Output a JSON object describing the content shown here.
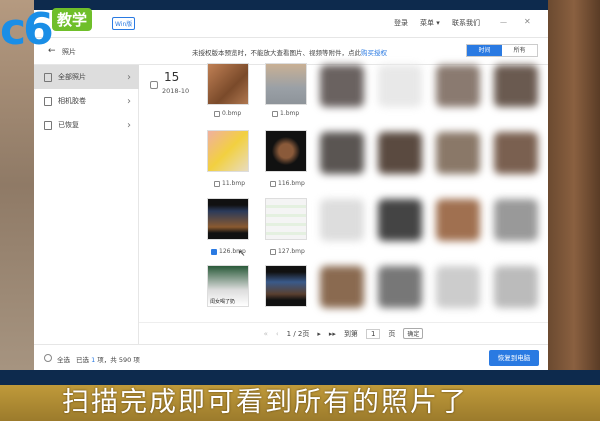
{
  "logo": {
    "text": "c6",
    "badge": "教学"
  },
  "titlebar": {
    "edition": "Win版",
    "login": "登录",
    "menu": "菜单 ▾",
    "contact": "联系我们",
    "minimize": "—",
    "close": "✕"
  },
  "toolbar": {
    "back": "←",
    "title": "照片",
    "notice": "未授权版本预览时，不能放大查看图片、视频等附件，点此",
    "buy": "购买授权",
    "tab_time": "时间",
    "tab_all": "所有"
  },
  "sidebar": {
    "items": [
      {
        "label": "全部照片"
      },
      {
        "label": "相机胶卷"
      },
      {
        "label": "已恢复"
      }
    ]
  },
  "group": {
    "day": "15",
    "month": "2018-10"
  },
  "photos": [
    {
      "name": "0.bmp",
      "checked": false
    },
    {
      "name": "1.bmp",
      "checked": false
    },
    {
      "name": "11.bmp",
      "checked": false
    },
    {
      "name": "116.bmp",
      "checked": false
    },
    {
      "name": "126.bmp",
      "checked": true
    },
    {
      "name": "127.bmp",
      "checked": false
    }
  ],
  "meme_caption": "闺女喝了奶",
  "pager": {
    "first": "«",
    "prev": "‹",
    "page": "1 / 2页",
    "next": "▸",
    "last": "▸▸",
    "goto": "到第",
    "value": "1",
    "unit": "页",
    "confirm": "确定"
  },
  "bottom": {
    "select_all": "全选",
    "selected_prefix": "已选",
    "selected_count": "1",
    "selected_suffix": "项，共 590 项",
    "restore": "恢复到电脑"
  },
  "caption": "扫描完成即可看到所有的照片了",
  "colors": {
    "accent": "#2a7ae2",
    "band": "#0d2a4d",
    "caption_bg": "#b38f35"
  }
}
